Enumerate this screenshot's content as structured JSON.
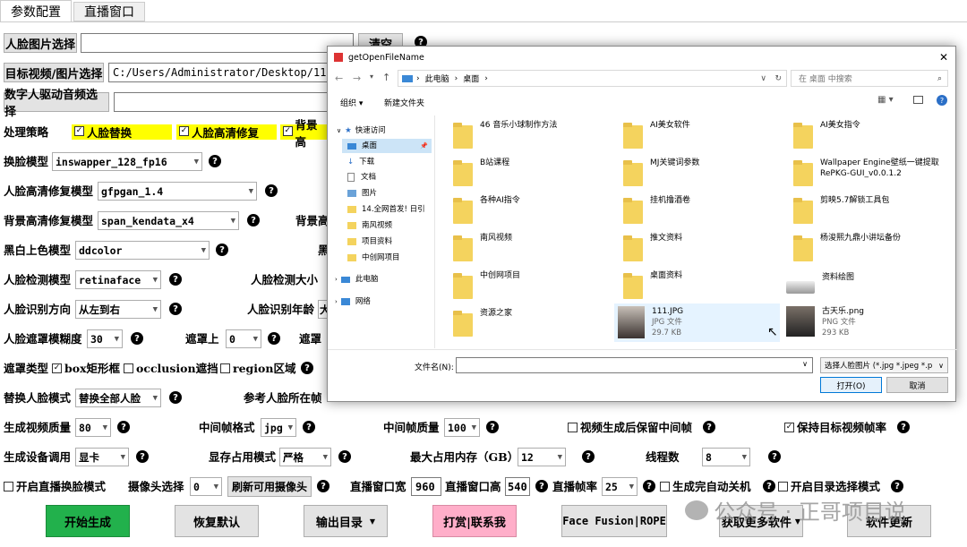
{
  "tabs": [
    "参数配置",
    "直播窗口"
  ],
  "rows": {
    "face_image_btn": "人脸图片选择",
    "clear_btn": "清空",
    "target_btn": "目标视频/图片选择",
    "target_path": "C:/Users/Administrator/Desktop/111.m",
    "audio_btn": "数字人驱动音频选择",
    "strategy_label": "处理策略",
    "strategy_opts": [
      "人脸替换",
      "人脸高清修复",
      "背景高"
    ],
    "swap_model_label": "换脸模型",
    "swap_model": "inswapper_128_fp16",
    "enhance_model_label": "人脸高清修复模型",
    "enhance_model": "gfpgan_1.4",
    "bg_model_label": "背景高清修复模型",
    "bg_model": "span_kendata_x4",
    "bg_label2": "背景高",
    "color_model_label": "黑白上色模型",
    "color_model": "ddcolor",
    "color_label2": "黑",
    "detect_model_label": "人脸检测模型",
    "detect_model": "retinaface",
    "detect_size_label": "人脸检测大小",
    "recog_dir_label": "人脸识别方向",
    "recog_dir": "从左到右",
    "recog_age_label": "人脸识别年龄",
    "recog_age": "大",
    "mask_blur_label": "人脸遮罩模糊度",
    "mask_blur": "30",
    "mask_top_label": "遮罩上",
    "mask_top": "0",
    "mask_label3": "遮罩",
    "mask_type_label": "遮罩类型",
    "mask_types": [
      "box矩形框",
      "occlusion遮挡",
      "region区域"
    ],
    "replace_mode_label": "替换人脸模式",
    "replace_mode": "替换全部人脸",
    "ref_face_label": "参考人脸所在帧",
    "quality_label": "生成视频质量",
    "quality": "80",
    "mid_fmt_label": "中间帧格式",
    "mid_fmt": "jpg",
    "mid_quality_label": "中间帧质量",
    "mid_quality": "100",
    "keep_mid_label": "视频生成后保留中间帧",
    "keep_fps_label": "保持目标视频帧率",
    "device_label": "生成设备调用",
    "device": "显卡",
    "vram_label": "显存占用模式",
    "vram": "严格",
    "maxmem_label": "最大占用内存（GB）",
    "maxmem": "12",
    "threads_label": "线程数",
    "threads": "8",
    "live_label": "开启直播换脸模式",
    "cam_label": "摄像头选择",
    "cam": "0",
    "refresh_cam": "刷新可用摄像头",
    "win_w_label": "直播窗口宽",
    "win_w": "960",
    "win_h_label": "直播窗口高",
    "win_h": "540",
    "fps_label": "直播帧率",
    "fps": "25",
    "shutdown_label": "生成完自动关机",
    "dirsel_label": "开启目录选择模式"
  },
  "buttons": {
    "start": "开始生成",
    "reset": "恢复默认",
    "output": "输出目录",
    "donate": "打赏|联系我",
    "ff": "Face Fusion|ROPE",
    "more": "获取更多软件",
    "update": "软件更新"
  },
  "watermark": "公众号 · 正哥项目说",
  "dialog": {
    "title": "getOpenFileName",
    "crumbs": [
      "此电脑",
      "桌面"
    ],
    "search_ph": "在 桌面 中搜索",
    "organize": "组织 ▾",
    "new_folder": "新建文件夹",
    "tree": [
      "快速访问",
      "桌面",
      "下载",
      "文档",
      "图片",
      "14.全网首发! 日引",
      "南风视频",
      "项目资料",
      "中创网项目",
      "此电脑",
      "网络"
    ],
    "files": [
      {
        "name": "46 音乐小球制作方法"
      },
      {
        "name": "AI美女软件"
      },
      {
        "name": "AI美女指令"
      },
      {
        "name": "B站课程"
      },
      {
        "name": "MJ关键词参数"
      },
      {
        "name": "Wallpaper Engine壁纸一键提取RePKG-GUI_v0.0.1.2"
      },
      {
        "name": "各种AI指令"
      },
      {
        "name": "挂机撸酒卷"
      },
      {
        "name": "剪映5.7解锁工具包"
      },
      {
        "name": "南风视频"
      },
      {
        "name": "推文资料"
      },
      {
        "name": "杨浚熙九鼎小讲坛备份"
      },
      {
        "name": "中创网项目"
      },
      {
        "name": "桌面资料"
      },
      {
        "name": "资料绘图"
      },
      {
        "name": "资源之家"
      },
      {
        "name": "111.JPG",
        "type": "JPG 文件",
        "size": "29.7 KB"
      },
      {
        "name": "古天乐.png",
        "type": "PNG 文件",
        "size": "293 KB"
      }
    ],
    "filename_label": "文件名(N):",
    "filter": "选择人脸图片 (*.jpg *.jpeg *.p",
    "open": "打开(O)",
    "cancel": "取消"
  }
}
